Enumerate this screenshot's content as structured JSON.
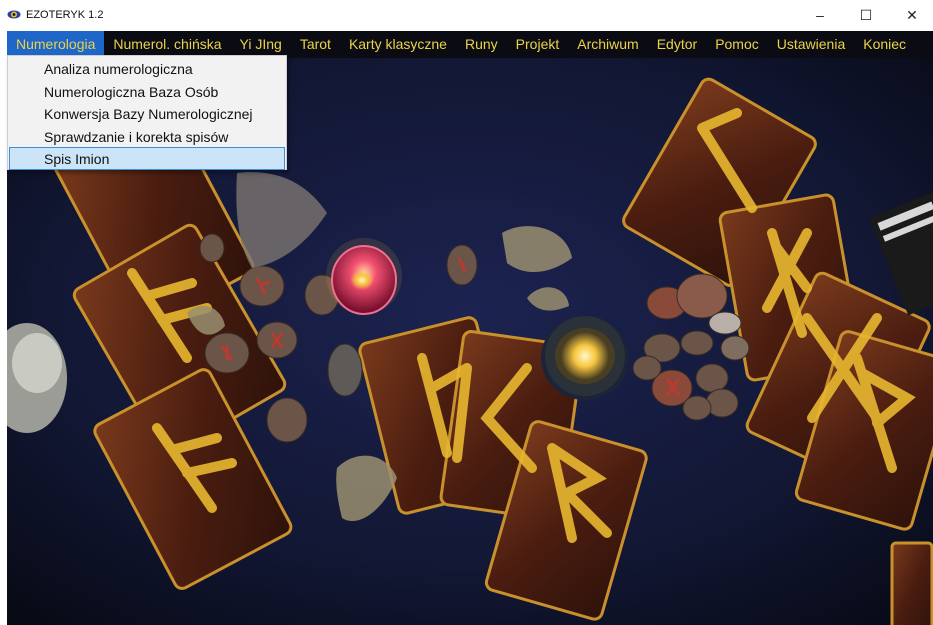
{
  "window": {
    "title": "EZOTERYK 1.2",
    "controls": {
      "minimize": "–",
      "maximize": "☐",
      "close": "✕"
    }
  },
  "menubar": {
    "items": [
      {
        "label": "Numerologia",
        "active": true
      },
      {
        "label": "Numerol. chińska"
      },
      {
        "label": "Yi JIng"
      },
      {
        "label": "Tarot"
      },
      {
        "label": "Karty klasyczne"
      },
      {
        "label": "Runy"
      },
      {
        "label": "Projekt"
      },
      {
        "label": "Archiwum"
      },
      {
        "label": "Edytor"
      },
      {
        "label": "Pomoc"
      },
      {
        "label": "Ustawienia"
      },
      {
        "label": "Koniec"
      }
    ]
  },
  "dropdown": {
    "items": [
      {
        "label": "Analiza numerologiczna"
      },
      {
        "label": "Numerologiczna Baza Osób"
      },
      {
        "label": "Konwersja Bazy Numerologicznej"
      },
      {
        "label": "Sprawdzanie i korekta spisów"
      },
      {
        "label": "Spis Imion",
        "selected": true
      }
    ]
  },
  "colors": {
    "menu_background": "#0b0c13",
    "menu_text": "#ecd24a",
    "menu_active": "#1e67c8",
    "dropdown_selected": "#cce4f7",
    "cloth": "#14193a"
  },
  "icons": {
    "app": "eye-logo-icon"
  }
}
